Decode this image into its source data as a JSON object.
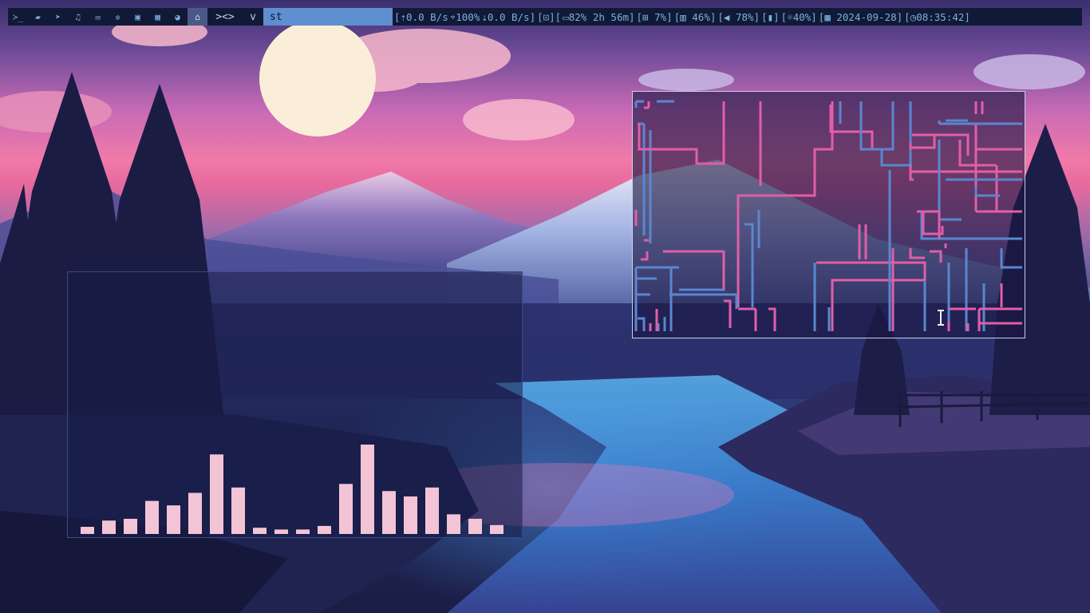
{
  "bar": {
    "workspaces": [
      {
        "icon": "terminal-icon",
        "glyph": "≻_"
      },
      {
        "icon": "folder-icon",
        "glyph": "▰"
      },
      {
        "icon": "telegram-icon",
        "glyph": "➤"
      },
      {
        "icon": "music-icon",
        "glyph": "♫"
      },
      {
        "icon": "mail-icon",
        "glyph": "✉"
      },
      {
        "icon": "bug-icon",
        "glyph": "✲"
      },
      {
        "icon": "image-icon",
        "glyph": "▣"
      },
      {
        "icon": "film-icon",
        "glyph": "▦"
      },
      {
        "icon": "pie-icon",
        "glyph": "◕"
      },
      {
        "icon": "bank-icon",
        "glyph": "⌂",
        "active": true
      }
    ],
    "layout_symbol": "><>",
    "mode_symbol": "v",
    "window_title": "st",
    "status": {
      "upload": "[⇡0.0 B/s",
      "wifi": "⌔100%",
      "download": "⇣0.0 B/s]",
      "lock": "[⊡][",
      "battery": "▭82% 2h 56m]",
      "cpu": "[⊞ 7%]",
      "memory": "[▥ 46%]",
      "volume": "[◀ 78%]",
      "mic": "[▮]",
      "brightness": "[☼40%]",
      "date": "[▦ 2024-09-28]",
      "time": "[◷08:35:42]"
    }
  },
  "visualizer": {
    "bar_color": "#f2c4d6",
    "levels": [
      0.08,
      0.15,
      0.17,
      0.37,
      0.32,
      0.46,
      0.89,
      0.52,
      0.07,
      0.05,
      0.05,
      0.09,
      0.56,
      1.0,
      0.48,
      0.42,
      0.52,
      0.22,
      0.17,
      0.1
    ]
  },
  "maze": {
    "colors": {
      "blue": "#5b86cf",
      "pink": "#e25ea8",
      "purple": "#9a5ec8"
    }
  },
  "colors": {
    "bar_bg": "#101a36",
    "bar_text": "#7eaede",
    "title_bg": "#5e8fd0"
  }
}
